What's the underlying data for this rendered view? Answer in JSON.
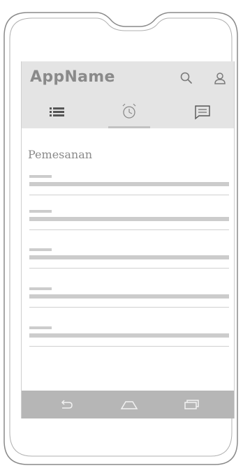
{
  "app": {
    "name": "AppName"
  },
  "icons": {
    "search": "search-icon",
    "user": "user-icon",
    "list": "list-icon",
    "alarm": "alarm-clock-icon",
    "chat": "chat-icon",
    "back": "back-icon",
    "home": "home-icon",
    "recent": "recent-apps-icon"
  },
  "tabs": {
    "active_index": 1
  },
  "main": {
    "title": "Pemesanan",
    "items": [
      {},
      {},
      {},
      {},
      {}
    ]
  },
  "colors": {
    "appbar": "#e4e4e4",
    "navbar": "#b6b6b6",
    "placeholder": "#cccccc",
    "text": "#8a8a8a"
  }
}
